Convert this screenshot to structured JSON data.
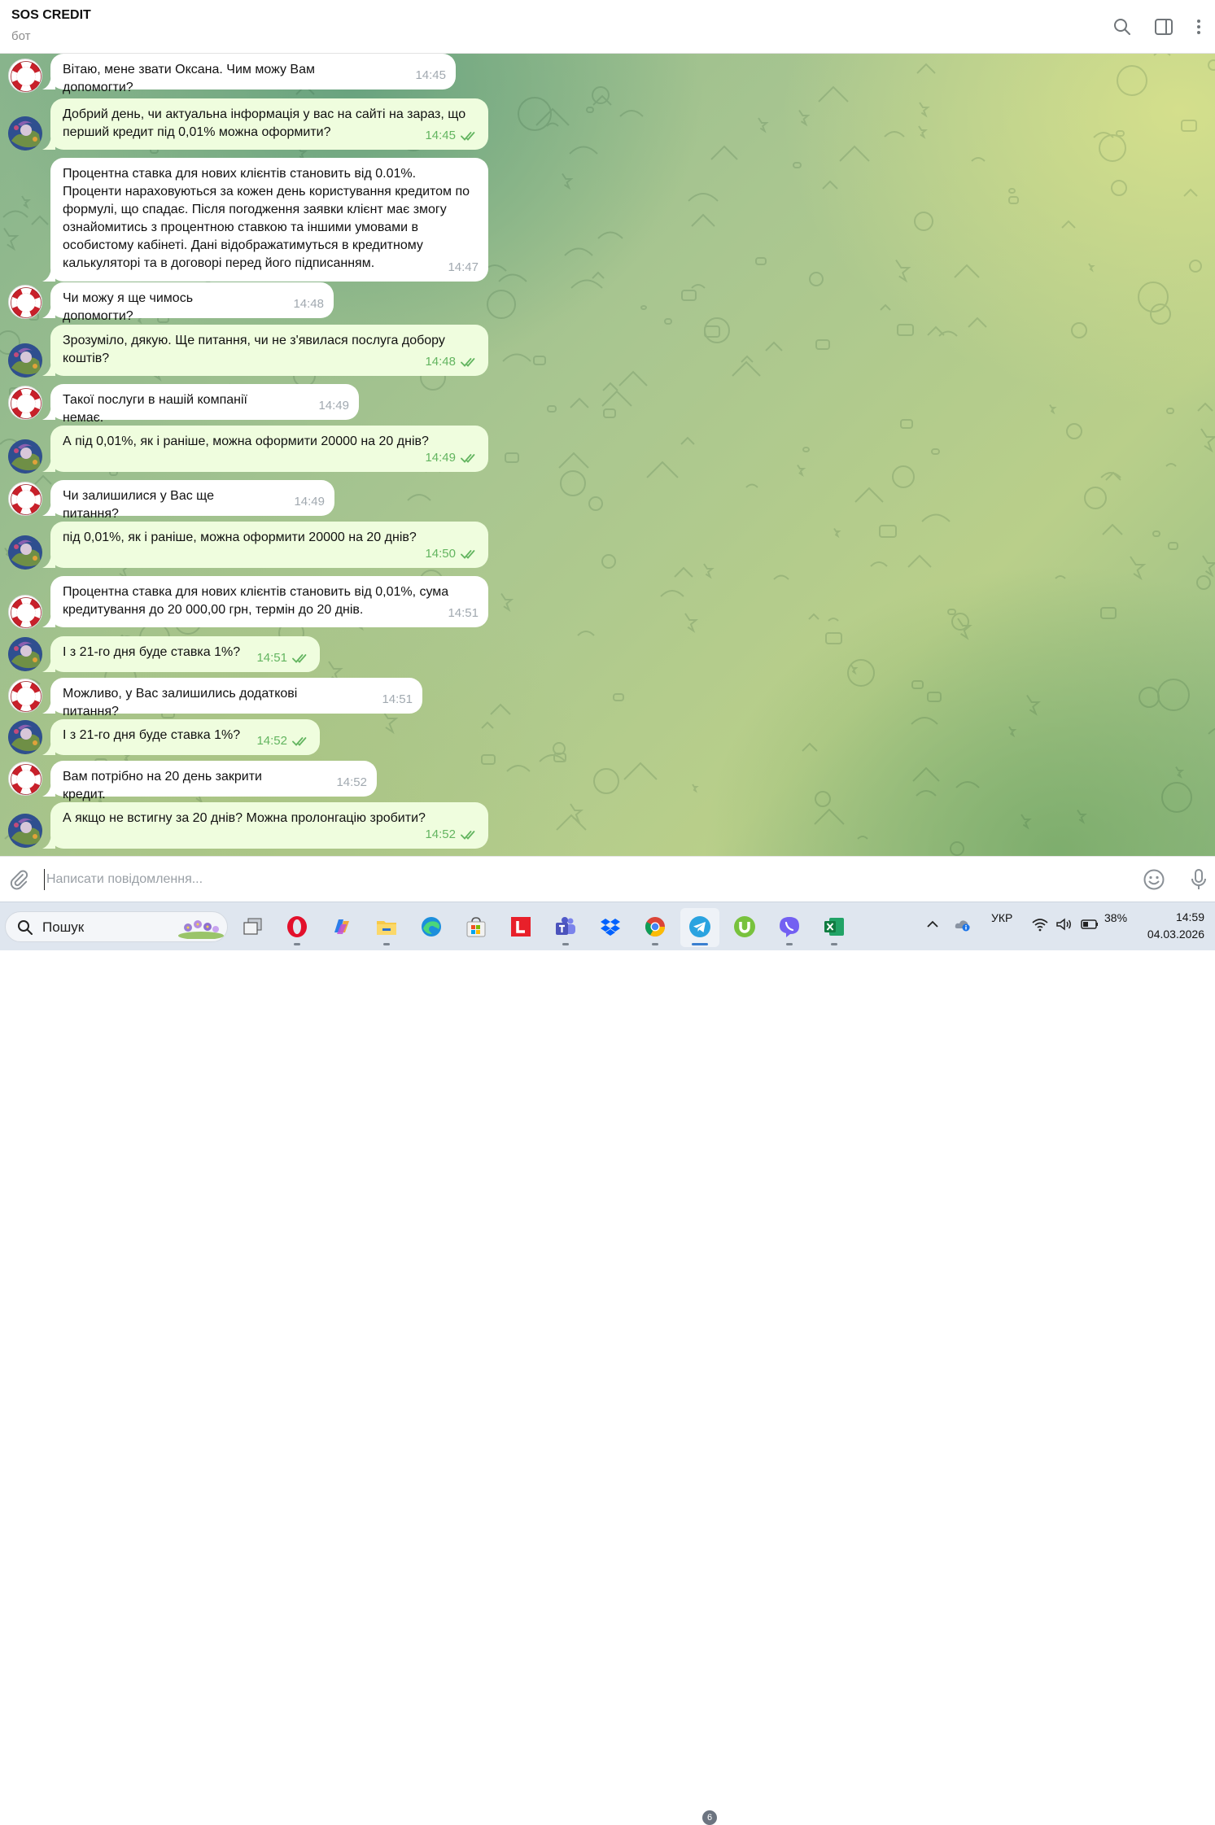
{
  "header": {
    "title": "SOS CREDIT",
    "subtitle": "бот",
    "icons": [
      "search-icon",
      "sidebar-toggle-icon",
      "more-vertical-icon"
    ]
  },
  "messages": [
    {
      "from": "bot",
      "text": "Вітаю, мене звати Оксана. Чим можу Вам допомогти?",
      "time": "14:45"
    },
    {
      "from": "user",
      "text": "Добрий день, чи актуальна інформація у вас на сайті на зараз, що перший кредит під 0,01% можна оформити?",
      "time": "14:45",
      "read": true
    },
    {
      "from": "bot",
      "text": "Процентна ставка для нових клієнтів становить від 0.01%. Проценти нараховуються за кожен день користування кредитом по формулі, що спадає. Після погодження заявки клієнт має змогу ознайомитись з процентною ставкою та іншими умовами в особистому кабінеті. Дані відображатимуться в кредитному калькуляторі та в договорі перед його підписанням.",
      "time": "14:47"
    },
    {
      "from": "bot",
      "text": "Чи можу я ще чимось допомогти?",
      "time": "14:48"
    },
    {
      "from": "user",
      "text": "Зрозуміло, дякую. Ще питання, чи не з'явилася послуга добору коштів?",
      "time": "14:48",
      "read": true
    },
    {
      "from": "bot",
      "text": "Такої послуги в нашій компанії немає.",
      "time": "14:49"
    },
    {
      "from": "user",
      "text": "А під 0,01%, як і раніше, можна оформити 20000 на 20 днів?",
      "time": "14:49",
      "read": true
    },
    {
      "from": "bot",
      "text": "Чи залишилися у Вас ще питання?",
      "time": "14:49"
    },
    {
      "from": "user",
      "text": "під 0,01%, як і раніше, можна оформити 20000 на 20 днів?",
      "time": "14:50",
      "read": true
    },
    {
      "from": "bot",
      "text": "Процентна ставка для нових клієнтів становить від 0,01%, сума кредитування до 20 000,00 грн, термін до 20 днів.",
      "time": "14:51"
    },
    {
      "from": "user",
      "text": "І з 21-го дня буде ставка 1%?",
      "time": "14:51",
      "read": true
    },
    {
      "from": "bot",
      "text": "Можливо, у Вас залишились додаткові питання?",
      "time": "14:51"
    },
    {
      "from": "user",
      "text": "І з 21-го дня буде ставка 1%?",
      "time": "14:52",
      "read": true
    },
    {
      "from": "bot",
      "text": "Вам потрібно на 20 день закрити кредит.",
      "time": "14:52"
    },
    {
      "from": "user",
      "text": "А якщо не встигну за 20 днів? Можна пролонгацію зробити?",
      "time": "14:52",
      "read": true
    }
  ],
  "composer": {
    "placeholder": "Написати повідомлення...",
    "icons": [
      "paperclip-icon",
      "emoji-icon",
      "microphone-icon"
    ]
  },
  "taskbar": {
    "search_label": "Пошук",
    "apps": [
      "task-view",
      "opera",
      "copilot",
      "file-explorer",
      "edge",
      "microsoft-store",
      "l-app",
      "teams",
      "dropbox",
      "chrome",
      "telegram",
      "utorrent",
      "viber",
      "excel"
    ],
    "telegram_badge": "6",
    "language": "УКР",
    "battery": "38%",
    "time": "14:59",
    "date": "04.03.2026"
  },
  "colors": {
    "user_bubble": "#effdde",
    "bot_bubble": "#ffffff",
    "read_ticks": "#63b560",
    "bot_time": "#a1a9b0"
  }
}
